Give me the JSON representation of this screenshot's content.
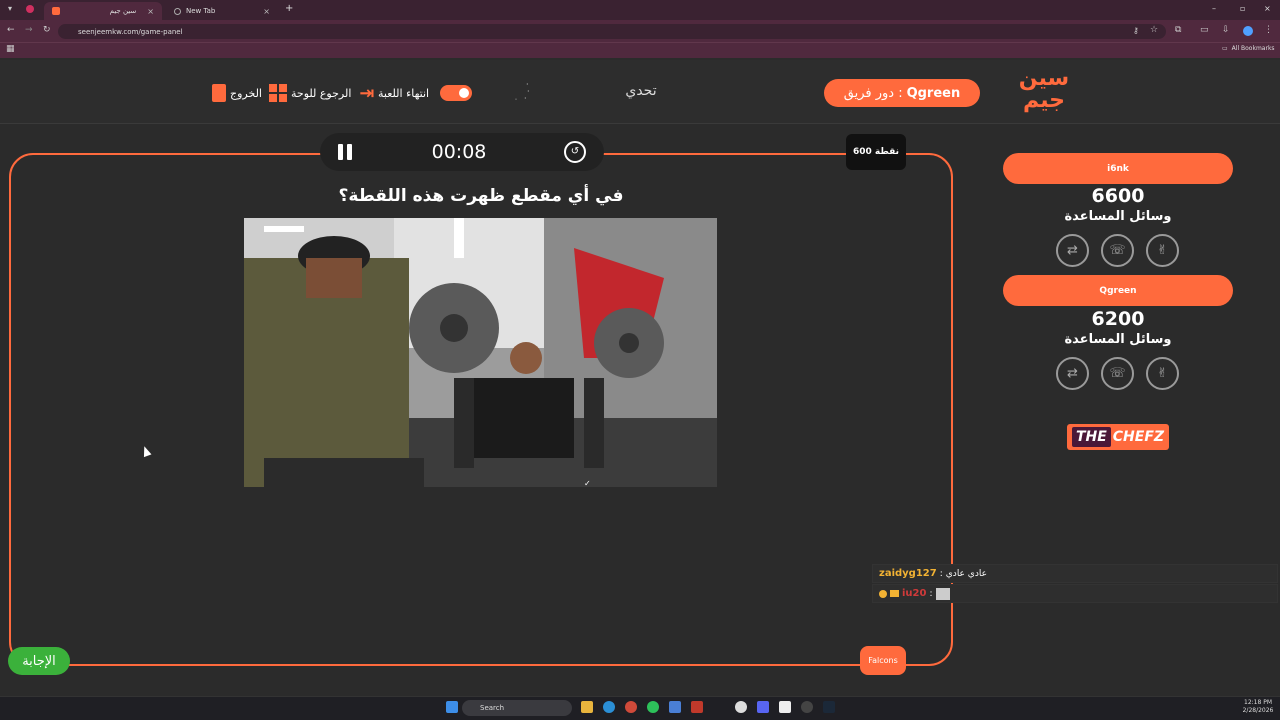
{
  "browser": {
    "tabs": [
      {
        "label": "سين جيم",
        "close": "×"
      },
      {
        "label": "New Tab",
        "close": "×"
      }
    ],
    "new_tab": "+",
    "window_controls": [
      "–",
      "▫",
      "×"
    ],
    "url": "seenjeemkw.com/game-panel",
    "bookmarks_label": "All Bookmarks"
  },
  "header": {
    "logo_text": "سين جيم",
    "turn_label": "دور فريق : ",
    "turn_team": "Qgreen",
    "category": "تحدي",
    "end_game": "انتهاء اللعبة",
    "back_board": "الرجوع للوحة",
    "exit": "الخروج"
  },
  "game": {
    "timer": "00:08",
    "points": "600 نقطة",
    "question": "في أي مقطع ظهرت هذه اللقطة؟",
    "answer_button": "الإجابة",
    "current_team_badge": "Falcons",
    "image_caption_mark": "✓"
  },
  "teams": [
    {
      "name": "i6nk",
      "score": "6600",
      "aids_label": "وسائل المساعدة"
    },
    {
      "name": "Qgreen",
      "score": "6200",
      "aids_label": "وسائل المساعدة"
    }
  ],
  "sponsor": {
    "part1": "THE",
    "part2": "CHEFZ"
  },
  "chat": [
    {
      "user": "zaidyg127",
      "sep": " : ",
      "msg": "عادي عادي"
    },
    {
      "user": "iu20",
      "sep": " : ",
      "msg": ""
    }
  ],
  "taskbar": {
    "search": "Search",
    "time": "12:18 PM",
    "date": "2/28/2026"
  },
  "colors": {
    "accent": "#ff6a3d",
    "answer_green": "#3bb13b",
    "bg": "#2b2b2b"
  }
}
